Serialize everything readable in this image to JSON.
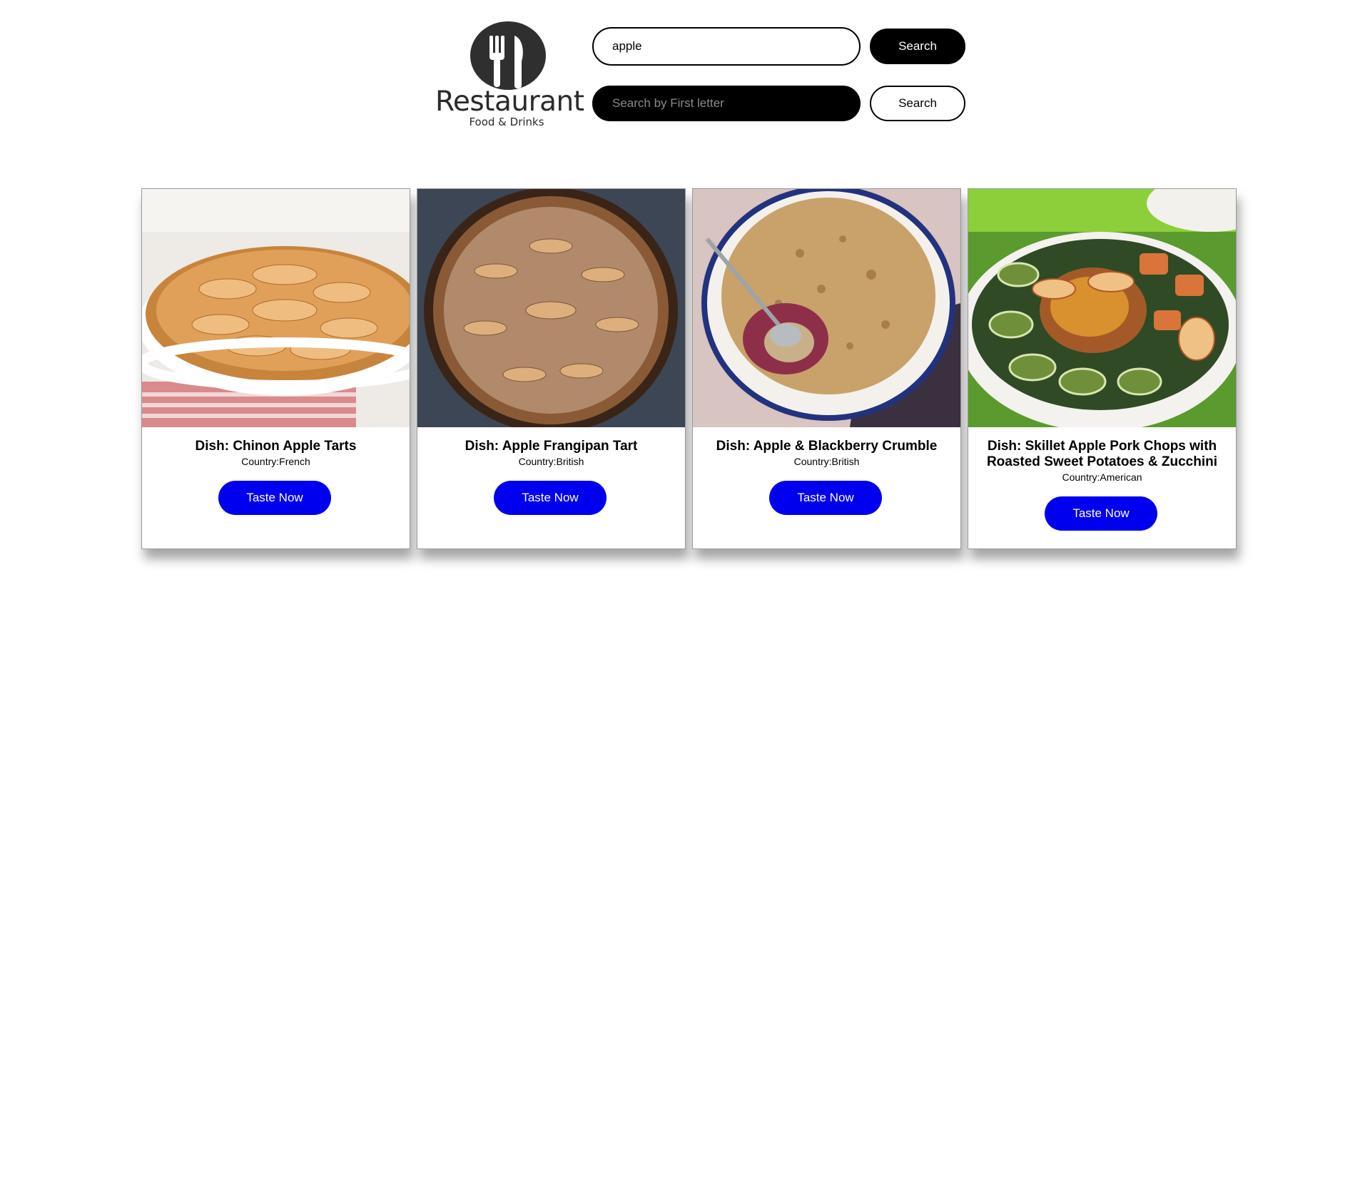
{
  "brand": {
    "name": "Restaurant",
    "tagline": "Food & Drinks"
  },
  "search": {
    "name_value": "apple",
    "name_button": "Search",
    "letter_placeholder": "Search by First letter",
    "letter_button": "Search"
  },
  "meals": [
    {
      "title": "Dish: Chinon Apple Tarts",
      "country": "Country:French",
      "button": "Taste Now",
      "image": "apple-tart-photo"
    },
    {
      "title": "Dish: Apple Frangipan Tart",
      "country": "Country:British",
      "button": "Taste Now",
      "image": "frangipan-tart-photo"
    },
    {
      "title": "Dish: Apple & Blackberry Crumble",
      "country": "Country:British",
      "button": "Taste Now",
      "image": "crumble-photo"
    },
    {
      "title": "Dish: Skillet Apple Pork Chops with Roasted Sweet Potatoes & Zucchini",
      "country": "Country:American",
      "button": "Taste Now",
      "image": "pork-chops-photo"
    }
  ],
  "colors": {
    "accent_button": "#0000ee",
    "dark": "#000000"
  }
}
